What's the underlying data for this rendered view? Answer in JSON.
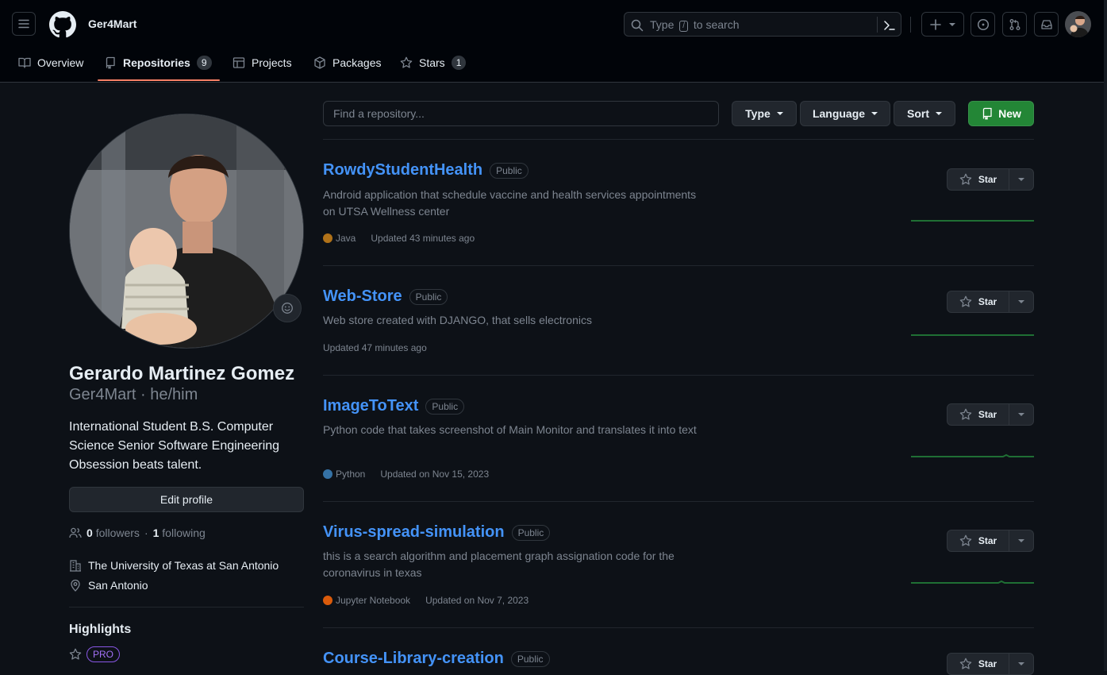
{
  "header": {
    "username": "Ger4Mart",
    "search_prefix": "Type",
    "search_key": "/",
    "search_suffix": "to search",
    "plus_label": "+",
    "icons": [
      "hamburger-icon",
      "github-logo-icon",
      "search-icon",
      "command-palette-icon",
      "plus-icon",
      "issues-icon",
      "pull-requests-icon",
      "inbox-icon",
      "user-avatar"
    ]
  },
  "tabs": [
    {
      "label": "Overview",
      "icon": "book-icon"
    },
    {
      "label": "Repositories",
      "icon": "repo-icon",
      "count": "9",
      "active": true
    },
    {
      "label": "Projects",
      "icon": "table-icon"
    },
    {
      "label": "Packages",
      "icon": "package-icon"
    },
    {
      "label": "Stars",
      "icon": "star-icon",
      "count": "1"
    }
  ],
  "profile": {
    "full_name": "Gerardo Martinez Gomez",
    "login_line": "Ger4Mart · he/him",
    "bio": "International Student B.S. Computer Science Senior Software Engineering Obsession beats talent.",
    "edit_label": "Edit profile",
    "followers_count": "0",
    "followers_label": "followers",
    "dot": "·",
    "following_count": "1",
    "following_label": "following",
    "organization": "The University of Texas at San Antonio",
    "location": "San Antonio",
    "highlights_title": "Highlights",
    "pro_badge": "PRO"
  },
  "filters": {
    "search_placeholder": "Find a repository...",
    "type_label": "Type",
    "language_label": "Language",
    "sort_label": "Sort",
    "new_label": "New",
    "accent_green": "#238636"
  },
  "repos": [
    {
      "name": "RowdyStudentHealth",
      "visibility": "Public",
      "description": "Android application that schedule vaccine and health services appointments on UTSA Wellness center",
      "language": "Java",
      "language_color": "#b07219",
      "updated": "Updated 43 minutes ago",
      "star_label": "Star"
    },
    {
      "name": "Web-Store",
      "visibility": "Public",
      "description": "Web store created with DJANGO, that sells electronics",
      "language": "",
      "language_color": "",
      "updated": "Updated 47 minutes ago",
      "star_label": "Star"
    },
    {
      "name": "ImageToText",
      "visibility": "Public",
      "description": "Python code that takes screenshot of Main Monitor and translates it into text",
      "language": "Python",
      "language_color": "#3572A5",
      "updated": "Updated on Nov 15, 2023",
      "star_label": "Star"
    },
    {
      "name": "Virus-spread-simulation",
      "visibility": "Public",
      "description": "this is a search algorithm and placement graph assignation code for the coronavirus in texas",
      "language": "Jupyter Notebook",
      "language_color": "#DA5B0B",
      "updated": "Updated on Nov 7, 2023",
      "star_label": "Star"
    },
    {
      "name": "Course-Library-creation",
      "visibility": "Public",
      "description": "",
      "language": "",
      "language_color": "",
      "updated": "",
      "star_label": "Star"
    }
  ]
}
